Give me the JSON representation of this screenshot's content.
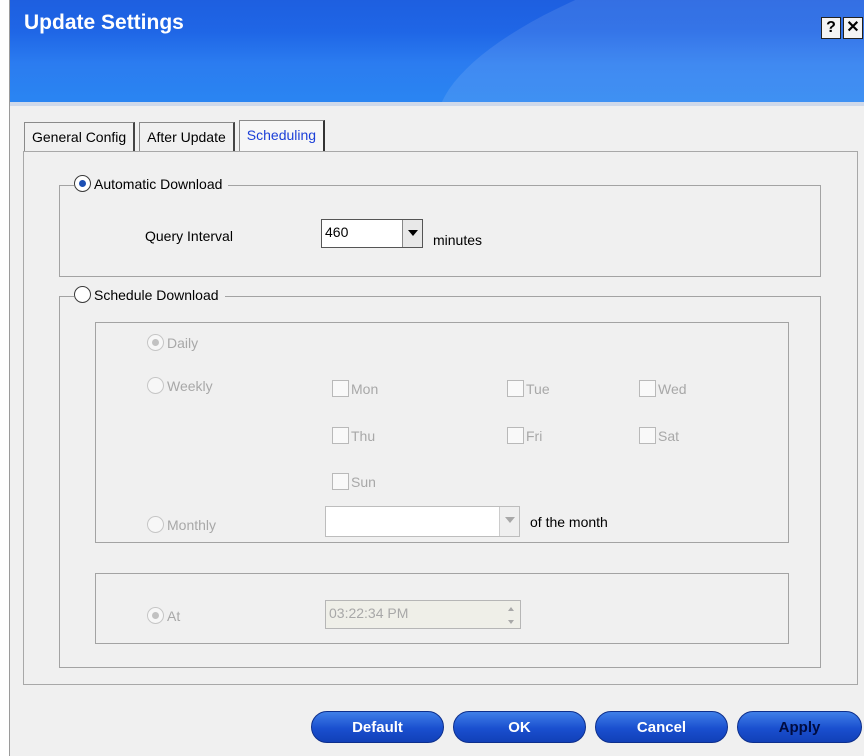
{
  "window": {
    "title": "Update Settings",
    "help_label": "?",
    "close_label": "✕"
  },
  "tabs": [
    {
      "label": "General Config",
      "active": false
    },
    {
      "label": "After Update",
      "active": false
    },
    {
      "label": "Scheduling",
      "active": true
    }
  ],
  "automatic": {
    "label": "Automatic Download",
    "selected": true,
    "query_interval_label": "Query Interval",
    "query_interval_value": "460",
    "unit_label": "minutes"
  },
  "schedule": {
    "label": "Schedule Download",
    "selected": false,
    "daily_label": "Daily",
    "weekly_label": "Weekly",
    "monthly_label": "Monthly",
    "days": {
      "mon": "Mon",
      "tue": "Tue",
      "wed": "Wed",
      "thu": "Thu",
      "fri": "Fri",
      "sat": "Sat",
      "sun": "Sun"
    },
    "monthly_value": "",
    "of_month_label": "of the month",
    "at_label": "At",
    "at_time": "03:22:34 PM"
  },
  "buttons": {
    "default": "Default",
    "ok": "OK",
    "cancel": "Cancel",
    "apply": "Apply"
  }
}
